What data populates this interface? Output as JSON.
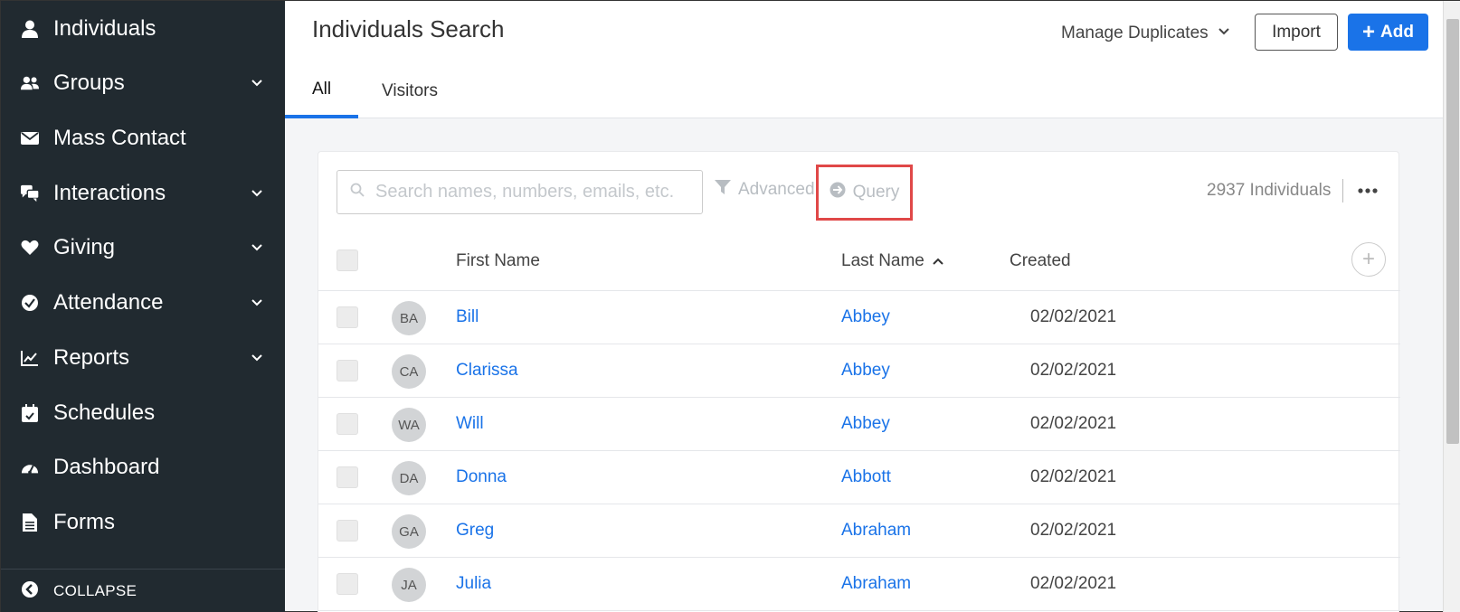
{
  "sidebar": {
    "items": [
      {
        "label": "Individuals",
        "icon": "user-icon",
        "has_chevron": false
      },
      {
        "label": "Groups",
        "icon": "users-icon",
        "has_chevron": true
      },
      {
        "label": "Mass Contact",
        "icon": "envelope-icon",
        "has_chevron": false
      },
      {
        "label": "Interactions",
        "icon": "chat-icon",
        "has_chevron": true
      },
      {
        "label": "Giving",
        "icon": "heart-icon",
        "has_chevron": true
      },
      {
        "label": "Attendance",
        "icon": "check-circle-icon",
        "has_chevron": true
      },
      {
        "label": "Reports",
        "icon": "chart-line-icon",
        "has_chevron": true
      },
      {
        "label": "Schedules",
        "icon": "calendar-icon",
        "has_chevron": false
      },
      {
        "label": "Dashboard",
        "icon": "gauge-icon",
        "has_chevron": false
      },
      {
        "label": "Forms",
        "icon": "document-icon",
        "has_chevron": false
      }
    ],
    "collapse_label": "COLLAPSE"
  },
  "header": {
    "title": "Individuals Search",
    "manage_duplicates": "Manage Duplicates",
    "import_label": "Import",
    "add_label": "Add",
    "tabs": [
      {
        "label": "All",
        "active": true
      },
      {
        "label": "Visitors",
        "active": false
      }
    ]
  },
  "toolbar": {
    "search_placeholder": "Search names, numbers, emails, etc.",
    "advanced_label": "Advanced",
    "query_label": "Query",
    "count_label": "2937 Individuals"
  },
  "table": {
    "columns": {
      "first_name": "First Name",
      "last_name": "Last Name",
      "created": "Created"
    },
    "rows": [
      {
        "initials": "BA",
        "first": "Bill",
        "last": "Abbey",
        "created": "02/02/2021"
      },
      {
        "initials": "CA",
        "first": "Clarissa",
        "last": "Abbey",
        "created": "02/02/2021"
      },
      {
        "initials": "WA",
        "first": "Will",
        "last": "Abbey",
        "created": "02/02/2021"
      },
      {
        "initials": "DA",
        "first": "Donna",
        "last": "Abbott",
        "created": "02/02/2021"
      },
      {
        "initials": "GA",
        "first": "Greg",
        "last": "Abraham",
        "created": "02/02/2021"
      },
      {
        "initials": "JA",
        "first": "Julia",
        "last": "Abraham",
        "created": "02/02/2021"
      }
    ]
  },
  "colors": {
    "sidebar_bg": "#212a30",
    "accent": "#1a73e8",
    "highlight_box": "#e04848"
  }
}
